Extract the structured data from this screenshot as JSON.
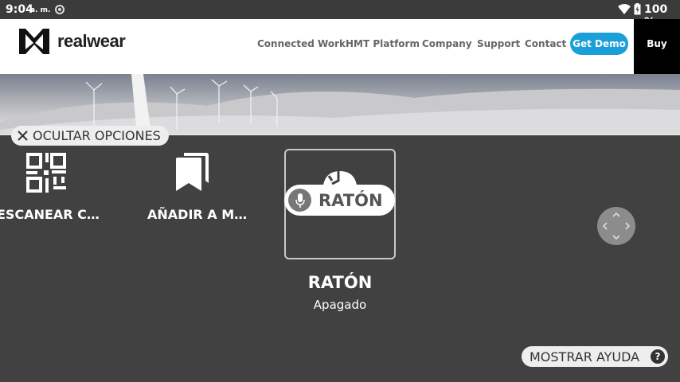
{
  "status_bar": {
    "time": "9:04",
    "ampm": "a. m.",
    "battery": "100 %"
  },
  "site": {
    "logo_text": "realwear",
    "nav": [
      "Connected Work",
      "HMT Platform",
      "Company",
      "Support",
      "Contact"
    ],
    "get_demo": "Get Demo",
    "buy_now": "Buy Now"
  },
  "overlay": {
    "hide_options": "OCULTAR OPCIONES",
    "options": [
      {
        "label": "ESCANEAR C…",
        "icon": "qr-code-icon"
      },
      {
        "label": "AÑADIR A M…",
        "icon": "bookmarks-icon"
      }
    ],
    "mouse": {
      "pill": "RATÓN",
      "title": "RATÓN",
      "status": "Apagado"
    },
    "show_help": "MOSTRAR AYUDA",
    "help_badge": "?"
  },
  "colors": {
    "background": "#414141",
    "accent": "#1a9fd8",
    "header": "#ffffff"
  }
}
